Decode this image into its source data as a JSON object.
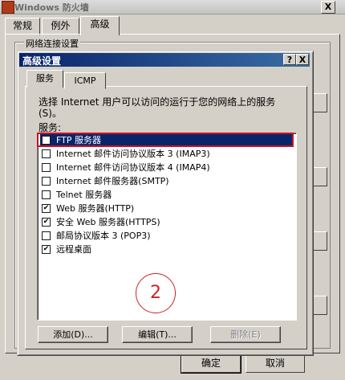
{
  "background_window": {
    "title": "Windows 防火墙",
    "close_label": "X",
    "tabs": [
      "常规",
      "例外",
      "高级"
    ],
    "group_label": "网络连接设置"
  },
  "dialog": {
    "title": "高级设置",
    "help_label": "?",
    "close_label": "X",
    "tabs": [
      "服务",
      "ICMP"
    ],
    "description": "选择 Internet 用户可以访问的运行于您的网络上的服务(S)。",
    "services_label": "服务:",
    "services": [
      {
        "label": "FTP 服务器",
        "checked": false,
        "selected": true
      },
      {
        "label": "Internet 邮件访问协议版本 3 (IMAP3)",
        "checked": false,
        "selected": false
      },
      {
        "label": "Internet 邮件访问协议版本 4 (IMAP4)",
        "checked": false,
        "selected": false
      },
      {
        "label": "Internet 邮件服务器(SMTP)",
        "checked": false,
        "selected": false
      },
      {
        "label": "Telnet 服务器",
        "checked": false,
        "selected": false
      },
      {
        "label": "Web 服务器(HTTP)",
        "checked": true,
        "selected": false
      },
      {
        "label": "安全 Web 服务器(HTTPS)",
        "checked": true,
        "selected": false
      },
      {
        "label": "邮局协议版本 3 (POP3)",
        "checked": false,
        "selected": false
      },
      {
        "label": "远程桌面",
        "checked": true,
        "selected": false
      }
    ],
    "annotation": "2",
    "buttons": {
      "add": "添加(D)...",
      "edit": "编辑(T)...",
      "delete": "删除(E)",
      "ok": "确定",
      "cancel": "取消"
    }
  },
  "colors": {
    "titlebar_active": "#0a246a",
    "selection": "#0a246a",
    "highlight_outline": "#cc1122",
    "annotation": "#cc2222",
    "face": "#d4d0c8"
  }
}
